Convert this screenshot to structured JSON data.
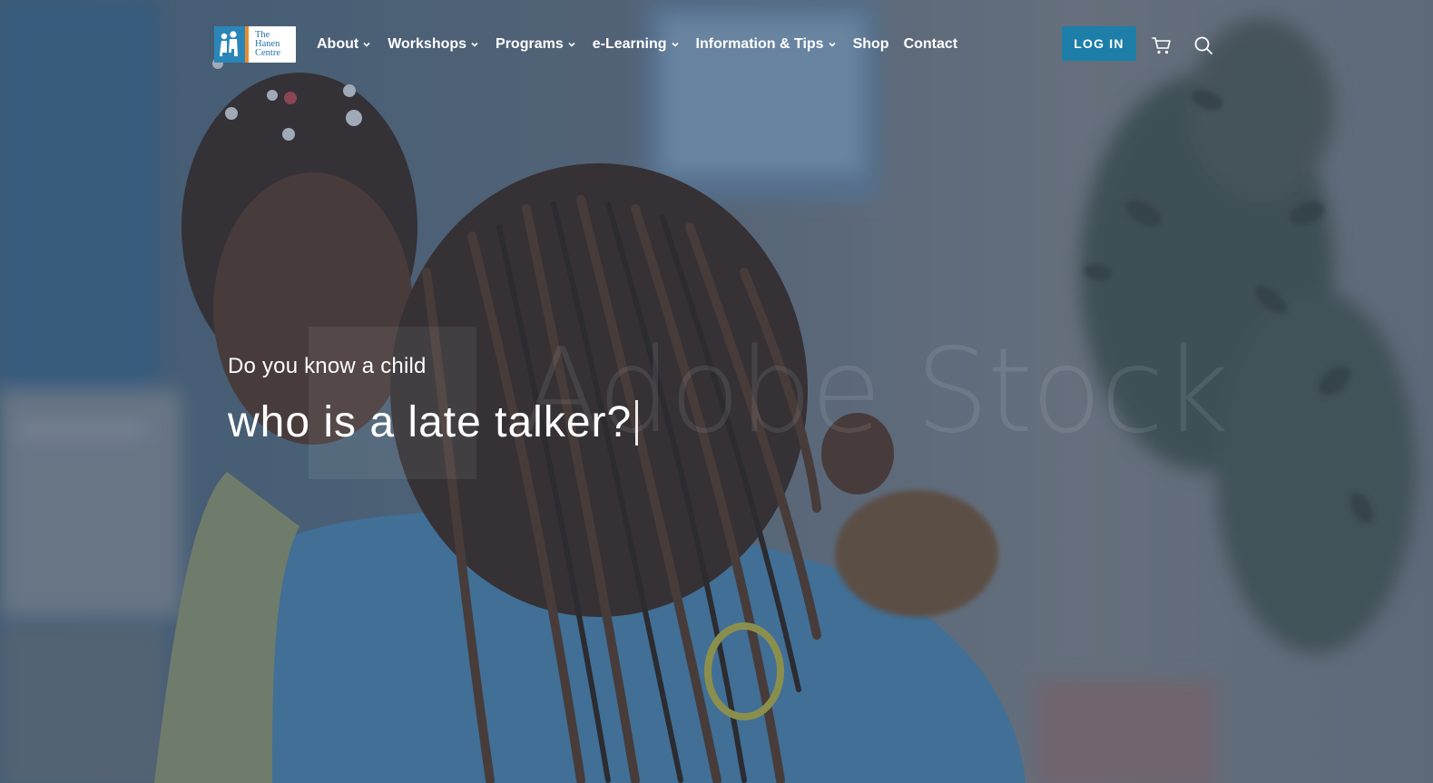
{
  "brand": {
    "logo_lines": [
      "The",
      "Hanen",
      "Centre"
    ],
    "logo_mark_color": "#2a86b8",
    "logo_accent_color": "#ea8b2d"
  },
  "nav": {
    "items": [
      {
        "label": "About",
        "has_dropdown": true
      },
      {
        "label": "Workshops",
        "has_dropdown": true
      },
      {
        "label": "Programs",
        "has_dropdown": true
      },
      {
        "label": "e-Learning",
        "has_dropdown": true
      },
      {
        "label": "Information & Tips",
        "has_dropdown": true
      },
      {
        "label": "Shop",
        "has_dropdown": false
      },
      {
        "label": "Contact",
        "has_dropdown": false
      }
    ]
  },
  "header_actions": {
    "login_label": "LOG IN",
    "login_color": "#1d7ea8",
    "cart_icon": "cart-icon",
    "search_icon": "search-icon"
  },
  "hero": {
    "eyebrow": "Do you know a child",
    "headline": "who is a late talker?",
    "watermark": "Adobe Stock"
  }
}
